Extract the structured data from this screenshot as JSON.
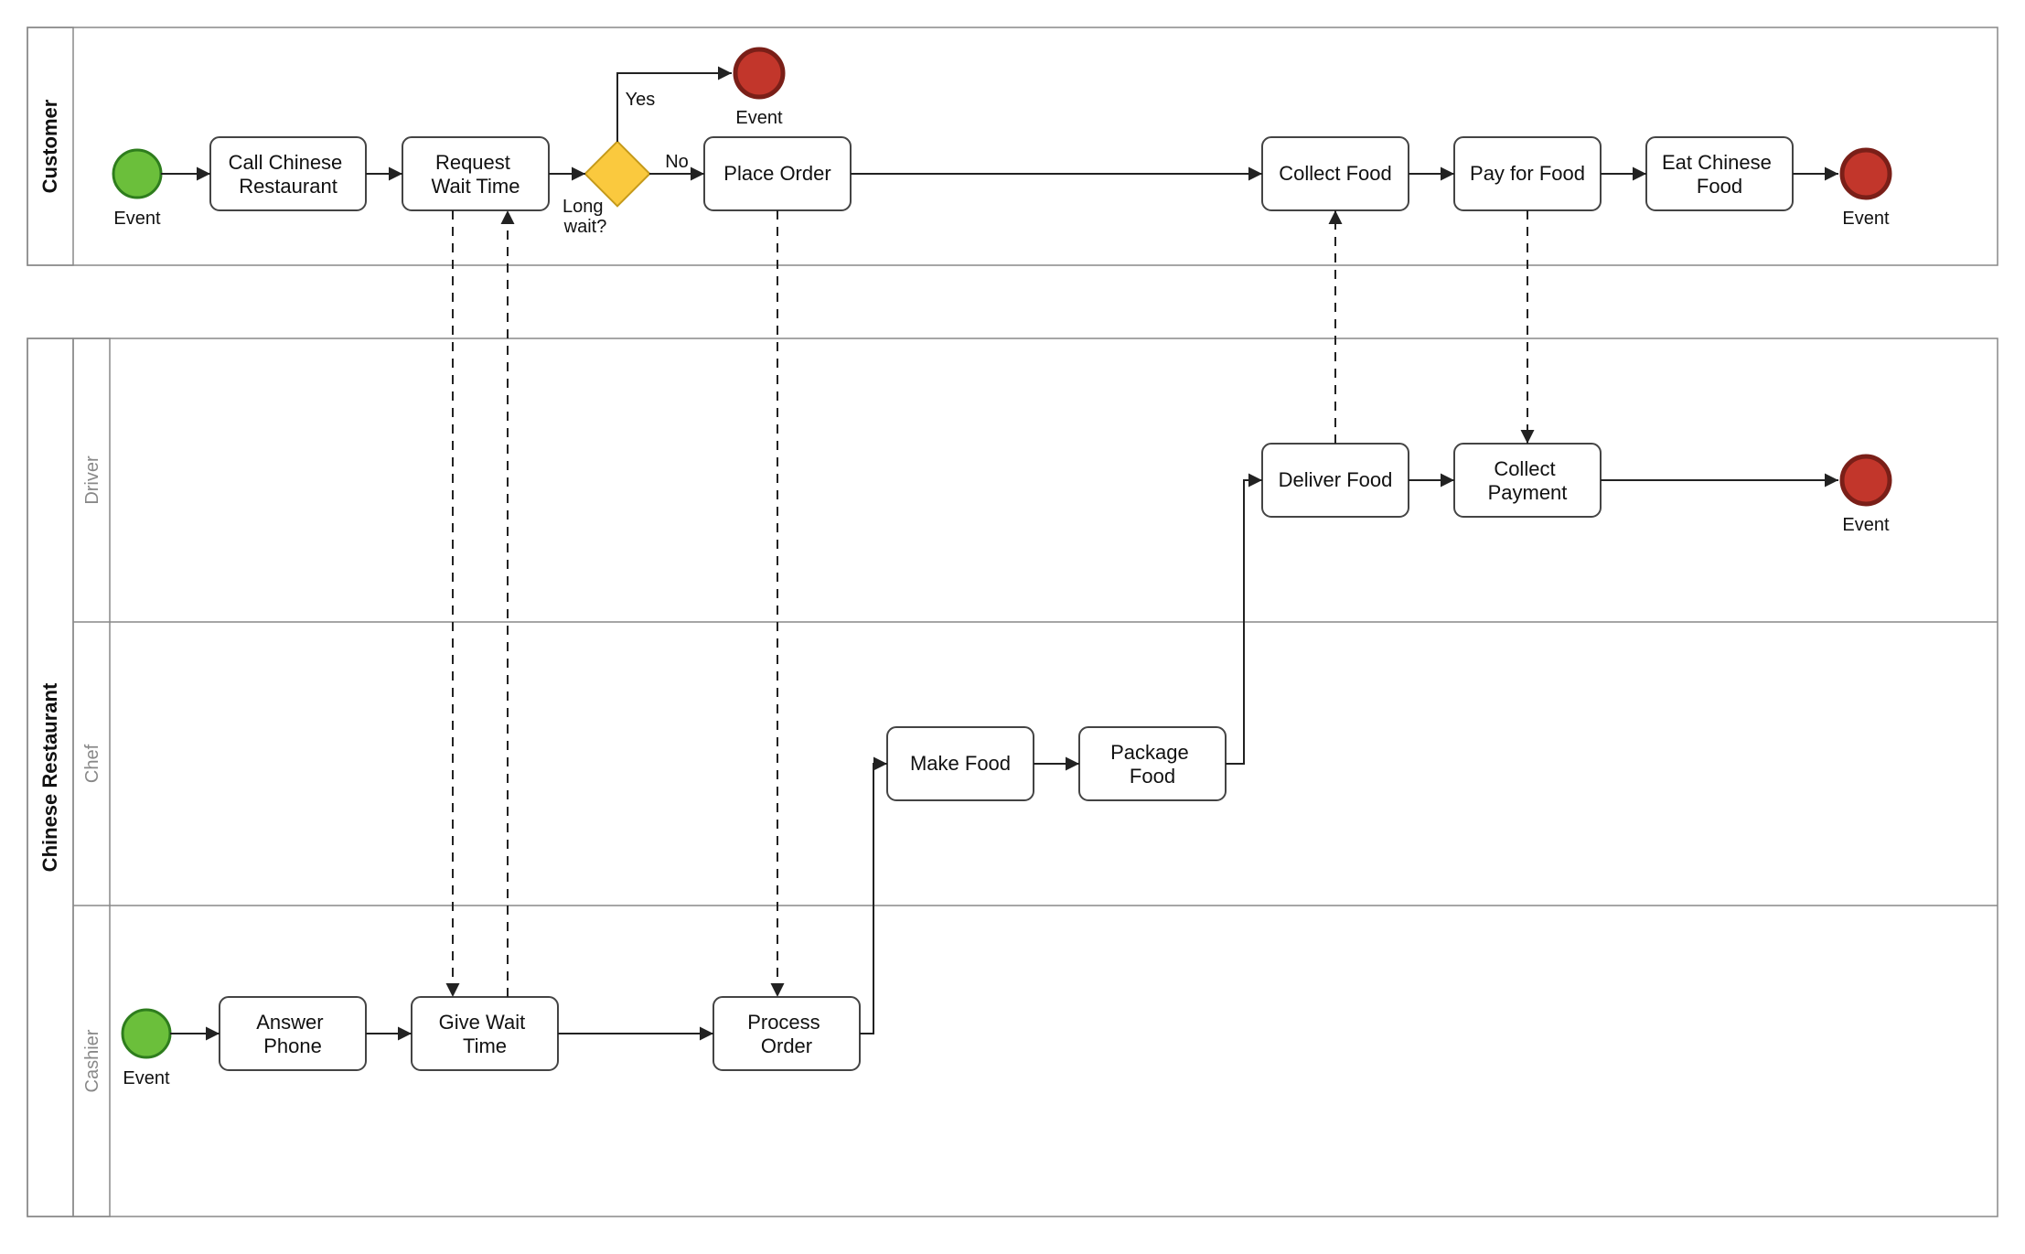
{
  "pools": {
    "customer": {
      "title": "Customer"
    },
    "restaurant": {
      "title": "Chinese Restaurant",
      "lanes": {
        "driver": "Driver",
        "chef": "Chef",
        "cashier": "Cashier"
      }
    }
  },
  "events": {
    "start_customer": "Event",
    "end_customer_abort": "Event",
    "end_customer_done": "Event",
    "start_cashier": "Event",
    "end_driver": "Event"
  },
  "tasks": {
    "call_restaurant": "Call Chinese Restaurant",
    "request_wait": "Request Wait Time",
    "place_order": "Place Order",
    "collect_food": "Collect Food",
    "pay_food": "Pay for Food",
    "eat_food": "Eat Chinese Food",
    "deliver_food": "Deliver Food",
    "collect_payment": "Collect Payment",
    "make_food": "Make Food",
    "package_food": "Package Food",
    "answer_phone": "Answer Phone",
    "give_wait": "Give Wait Time",
    "process_order": "Process Order"
  },
  "gateway": {
    "long_wait_label": "Long wait?",
    "yes": "Yes",
    "no": "No"
  }
}
